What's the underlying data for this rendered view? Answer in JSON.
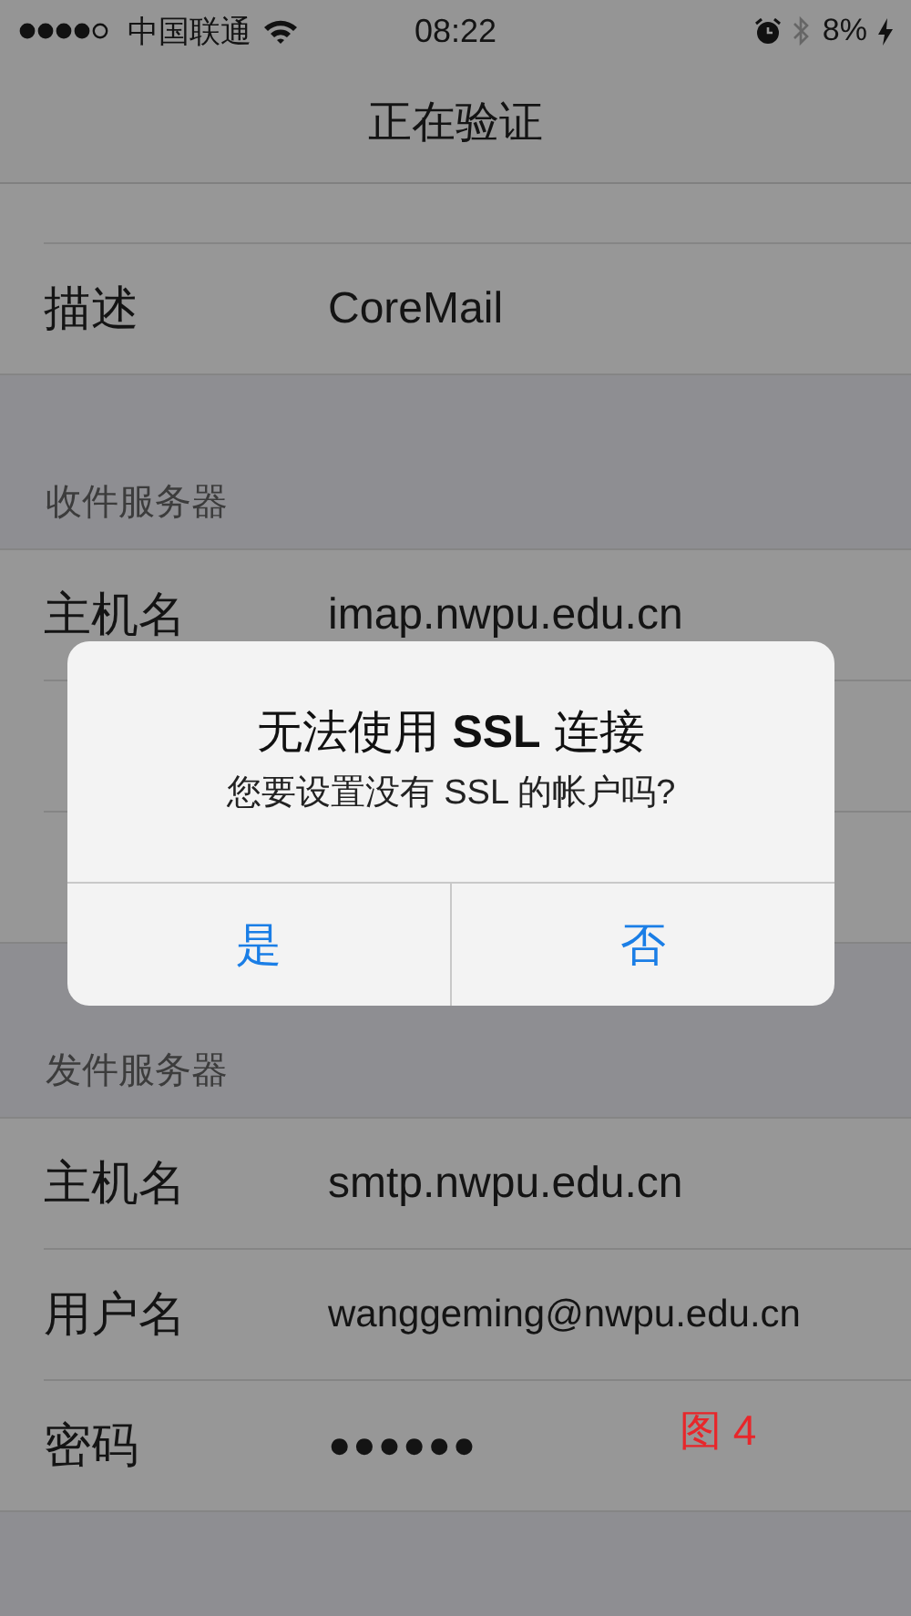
{
  "status_bar": {
    "carrier": "中国联通",
    "time": "08:22",
    "battery": "8%"
  },
  "nav": {
    "title": "正在验证"
  },
  "sections": [
    {
      "rows": [
        {
          "kind": "hidden"
        },
        {
          "label": "描述",
          "value": "CoreMail"
        }
      ]
    },
    {
      "header": "收件服务器",
      "rows": [
        {
          "label": "主机名",
          "value": "imap.nwpu.edu.cn"
        },
        {
          "kind": "hidden"
        },
        {
          "kind": "hidden"
        }
      ]
    },
    {
      "header": "发件服务器",
      "rows": [
        {
          "label": "主机名",
          "value": "smtp.nwpu.edu.cn"
        },
        {
          "label": "用户名",
          "value": "wanggeming@nwpu.edu.cn",
          "small": true
        },
        {
          "label": "密码",
          "value": "●●●●●●",
          "kind": "secure"
        }
      ]
    }
  ],
  "alert": {
    "title": "无法使用 **SSL** 连接",
    "message": "您要设置没有 SSL 的帐户吗?",
    "buttons": [
      "是",
      "否"
    ]
  },
  "annotation": {
    "text": "图 4"
  }
}
